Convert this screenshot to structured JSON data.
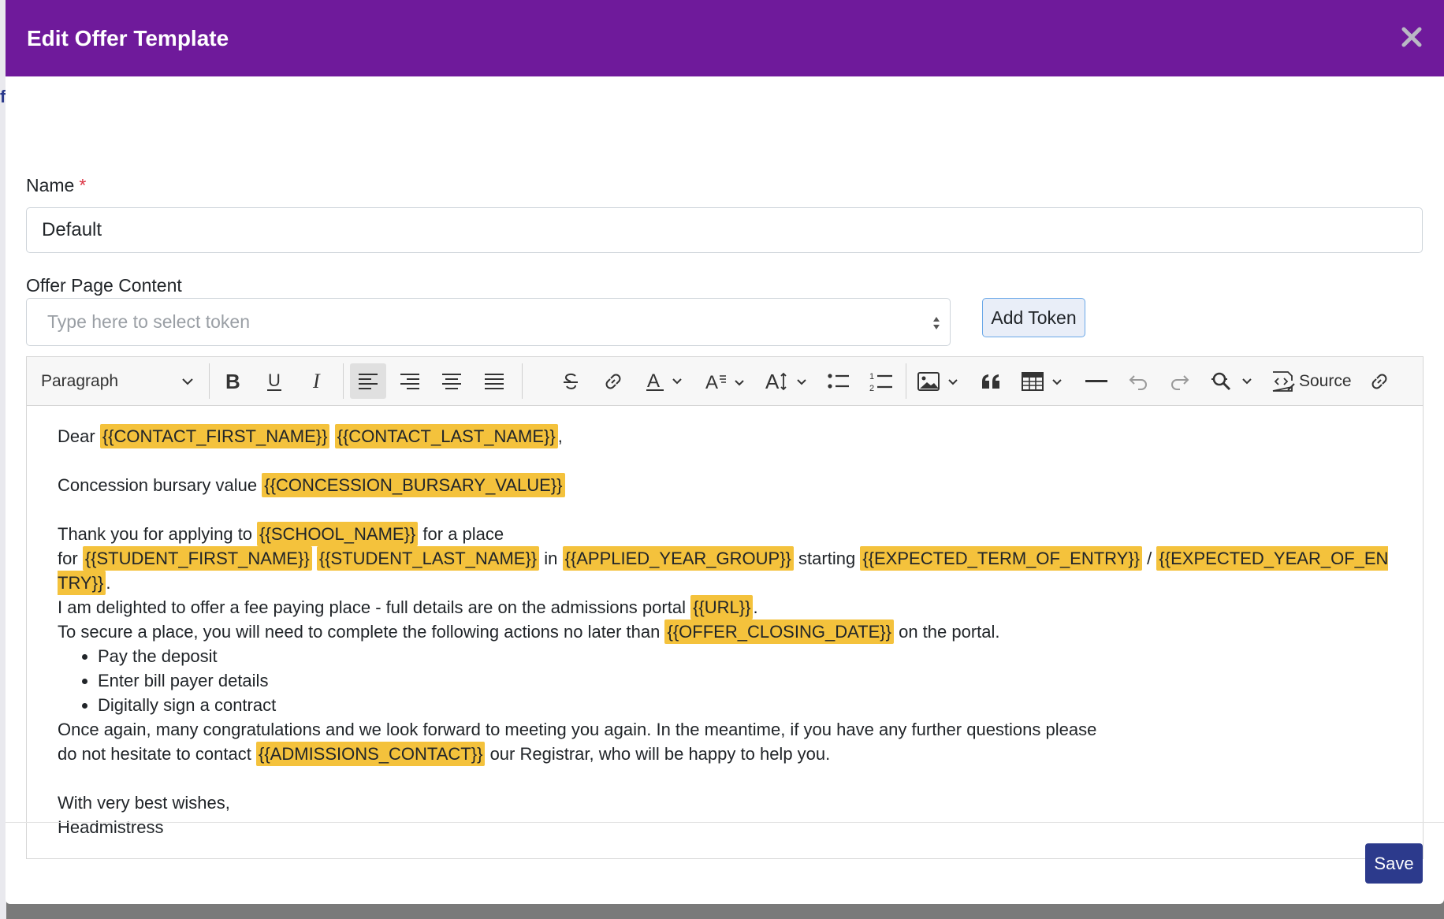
{
  "modal": {
    "title": "Edit Offer Template",
    "close_icon": "close-icon"
  },
  "form": {
    "name_label": "Name",
    "required_marker": "*",
    "name_value": "Default",
    "content_label": "Offer Page Content",
    "token_placeholder": "Type here to select token",
    "add_token_label": "Add Token"
  },
  "toolbar": {
    "paragraph_label": "Paragraph",
    "source_label": "Source",
    "icons": [
      "chevron-down-icon",
      "bold-icon",
      "underline-icon",
      "italic-icon",
      "align-left-icon",
      "align-right-icon",
      "align-center-icon",
      "align-justify-icon",
      "strikethrough-icon",
      "link-icon",
      "font-color-icon",
      "font-family-icon",
      "font-size-icon",
      "bulleted-list-icon",
      "numbered-list-icon",
      "image-icon",
      "blockquote-icon",
      "table-icon",
      "horizontal-line-icon",
      "undo-icon",
      "redo-icon",
      "find-replace-icon",
      "source-icon",
      "unlink-icon"
    ]
  },
  "content": {
    "dear": "Dear",
    "tok_first_name": "{{CONTACT_FIRST_NAME}}",
    "tok_last_name": "{{CONTACT_LAST_NAME}}",
    "comma": ",",
    "concession_text": "Concession bursary value",
    "tok_concession": "{{CONCESSION_BURSARY_VALUE}}",
    "thank_you": "Thank you for applying to",
    "tok_school": "{{SCHOOL_NAME}}",
    "for_a_place": "for a place",
    "for": "for",
    "tok_student_first": "{{STUDENT_FIRST_NAME}}",
    "tok_student_last": "{{STUDENT_LAST_NAME}}",
    "in": "in",
    "tok_year_group": "{{APPLIED_YEAR_GROUP}}",
    "starting": "starting",
    "tok_term": "{{EXPECTED_TERM_OF_ENTRY}}",
    "slash": "/",
    "tok_year_entry": "{{EXPECTED_YEAR_OF_ENTRY}}",
    "period": ".",
    "delighted": "I am delighted to offer a fee paying place - full details are on the admissions portal",
    "tok_url": "{{URL}}",
    "secure": "To secure a place, you will need to complete the following actions no later than",
    "tok_closing": "{{OFFER_CLOSING_DATE}}",
    "on_portal": "on the portal.",
    "actions": [
      "Pay the deposit",
      "Enter bill payer details",
      "Digitally sign a contract"
    ],
    "once_again": "Once again, many congratulations and we look forward to meeting you again. In the meantime, if you have any further questions please do not hesitate to",
    "contact": "contact",
    "tok_admissions": "{{ADMISSIONS_CONTACT}}",
    "registrar": "our Registrar, who will be happy to help you.",
    "wishes": "With very best wishes,",
    "signoff": "Headmistress"
  },
  "footer": {
    "save_label": "Save"
  },
  "colors": {
    "header": "#6f1a9b",
    "token_highlight": "#f4c23c",
    "save_button": "#2c3a8c"
  }
}
